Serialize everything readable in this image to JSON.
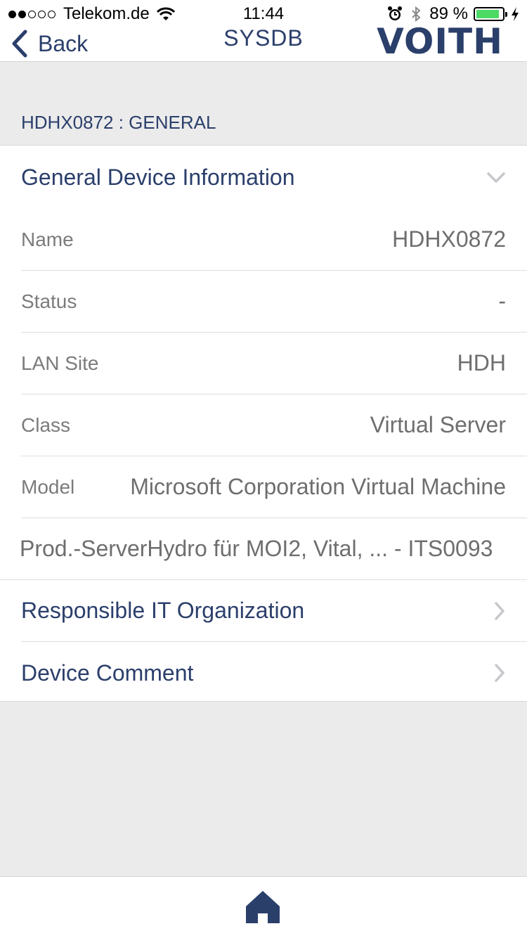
{
  "status_bar": {
    "carrier": "Telekom.de",
    "time": "11:44",
    "battery_percent": "89 %",
    "battery_level": 0.89,
    "battery_color": "#4cd964"
  },
  "nav": {
    "back_label": "Back",
    "title": "SYSDB",
    "logo_text": "VOITH"
  },
  "section": {
    "header": "HDHX0872 : GENERAL"
  },
  "general": {
    "title": "General Device Information",
    "rows": [
      {
        "key": "Name",
        "value": "HDHX0872"
      },
      {
        "key": "Status",
        "value": "-"
      },
      {
        "key": "LAN Site",
        "value": "HDH"
      },
      {
        "key": "Class",
        "value": "Virtual Server"
      },
      {
        "key": "Model",
        "value": "Microsoft Corporation Virtual Machine"
      }
    ],
    "description": "Prod.-ServerHydro für MOI2, Vital, ... - ITS0093"
  },
  "links": [
    {
      "label": "Responsible IT Organization"
    },
    {
      "label": "Device Comment"
    }
  ],
  "icons": {
    "back": "chevron-left-icon",
    "collapse": "chevron-down-icon",
    "link": "chevron-right-icon",
    "home": "home-icon"
  },
  "colors": {
    "accent": "#2b3f6b",
    "background": "#ebebeb"
  }
}
